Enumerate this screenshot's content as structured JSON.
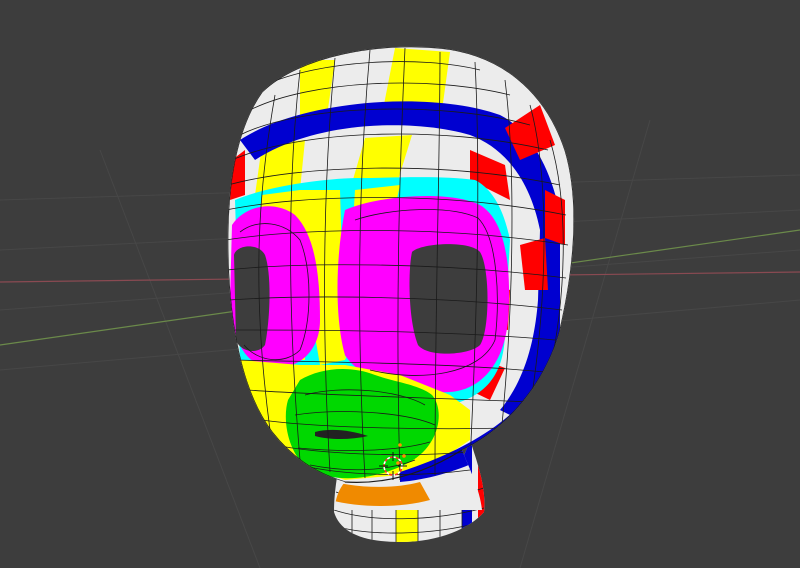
{
  "viewport": {
    "background": "#3d3d3d",
    "grid_color": "#474747",
    "x_axis_color": "#8a4a52",
    "y_axis_color": "#6b8a4a"
  },
  "mesh": {
    "object": "head",
    "face_colors": {
      "white": "#ececec",
      "yellow": "#ffff00",
      "blue": "#0000d0",
      "red": "#ff0000",
      "cyan": "#00ffff",
      "magenta": "#ff00ff",
      "green": "#00d800",
      "orange": "#f08a00"
    },
    "wire_color": "#1a1a1a",
    "cursor_icon": "3d-cursor-icon"
  }
}
